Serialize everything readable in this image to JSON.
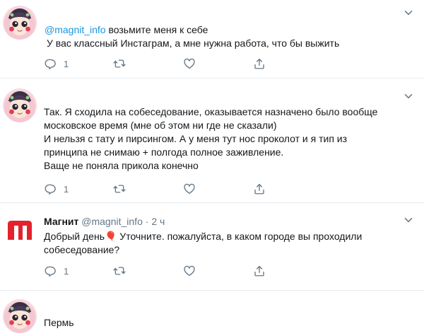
{
  "tweets": [
    {
      "mention": "@magnit_info",
      "text_first": " возьмите меня к себе",
      "body": "У вас классный Инстаграм, а мне нужна работа, что бы выжить",
      "reply_count": "1"
    },
    {
      "body": "Так. Я сходила на собеседование, оказывается назначено было вообще\nмосковское время (мне об этом ни где не сказали)\nИ нельзя с тату и пирсингом. А у меня тут нос проколот и я тип из\nпринципа не снимаю + полгода полное заживление.\nВаще не поняла прикола конечно",
      "reply_count": "1"
    },
    {
      "name": "Магнит",
      "handle": "@magnit_info",
      "separator": "·",
      "time": "2 ч",
      "body": "Добрый день🎈 Уточните. пожалуйста, в каком городе вы проходили\nсобеседование?",
      "reply_count": "1"
    },
    {
      "body": "Пермь"
    }
  ],
  "icons": {
    "reply": "reply-icon",
    "retweet": "retweet-icon",
    "like": "heart-icon",
    "share": "share-icon",
    "more": "chevron-down-icon"
  },
  "colors": {
    "link": "#1b95e0",
    "meta": "#657786",
    "magnit_red": "#e3222d"
  }
}
